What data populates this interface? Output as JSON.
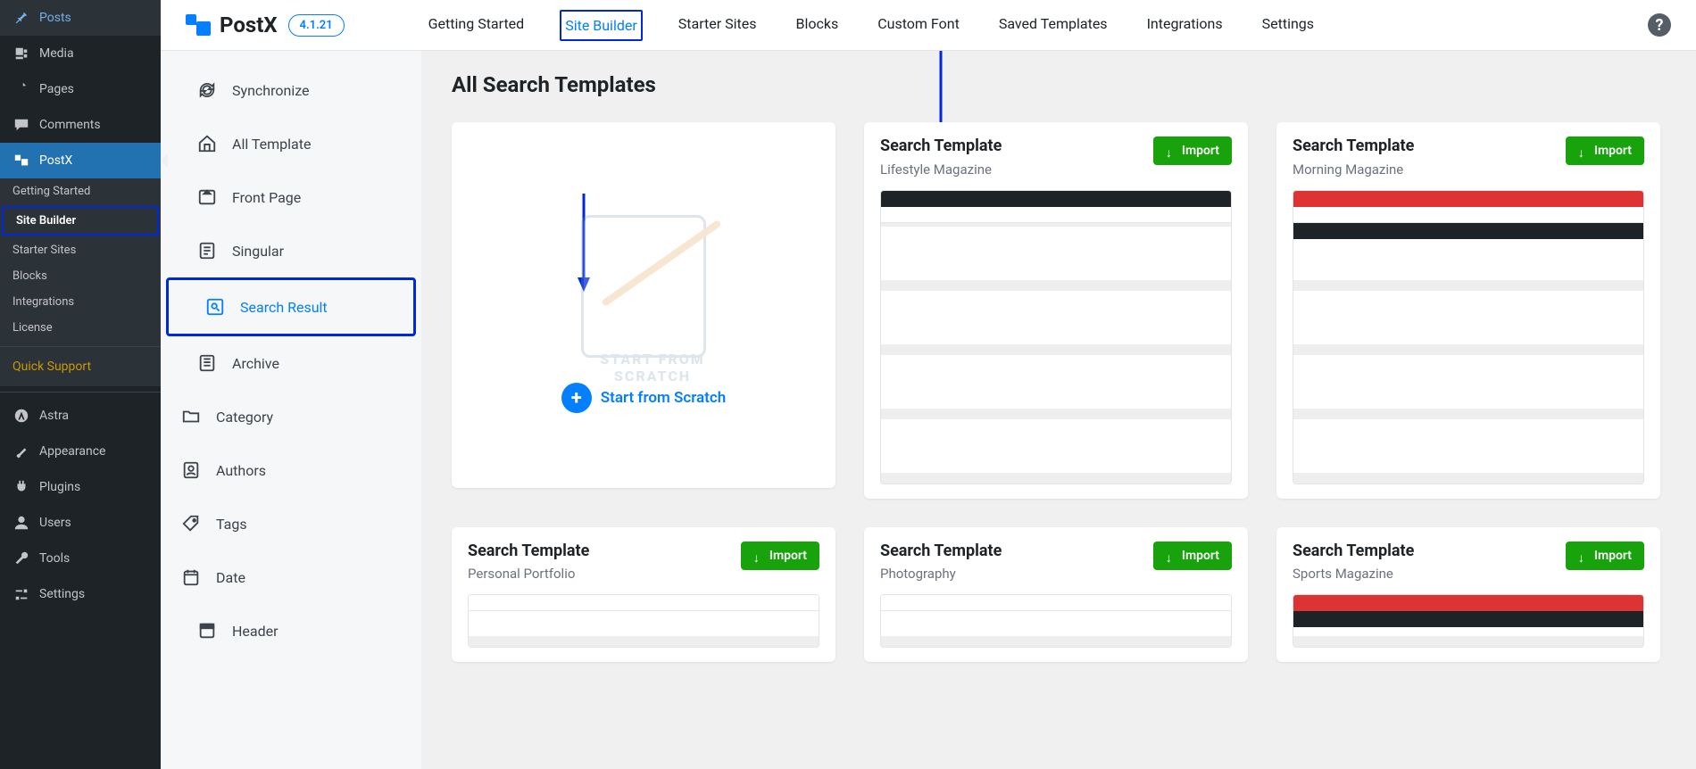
{
  "wp": {
    "posts": "Posts",
    "media": "Media",
    "pages": "Pages",
    "comments": "Comments",
    "postx": "PostX",
    "sub": {
      "getting_started": "Getting Started",
      "site_builder": "Site Builder",
      "starter_sites": "Starter Sites",
      "blocks": "Blocks",
      "integrations": "Integrations",
      "license": "License",
      "quick_support": "Quick Support"
    },
    "astra": "Astra",
    "appearance": "Appearance",
    "plugins": "Plugins",
    "users": "Users",
    "tools": "Tools",
    "settings": "Settings"
  },
  "top": {
    "brand": "PostX",
    "version": "4.1.21",
    "nav": {
      "getting_started": "Getting Started",
      "site_builder": "Site Builder",
      "starter_sites": "Starter Sites",
      "blocks": "Blocks",
      "custom_font": "Custom Font",
      "saved_templates": "Saved Templates",
      "integrations": "Integrations",
      "settings": "Settings"
    },
    "help": "?"
  },
  "builder": {
    "synchronize": "Synchronize",
    "all_template": "All Template",
    "front_page": "Front Page",
    "singular": "Singular",
    "search_result": "Search Result",
    "archive": "Archive",
    "category": "Category",
    "authors": "Authors",
    "tags": "Tags",
    "date": "Date",
    "header": "Header"
  },
  "content": {
    "title": "All Search Templates",
    "scratch_label": "Start from Scratch",
    "scratch_ghost": "START FROM SCRATCH",
    "import_label": "Import",
    "cards": [
      {
        "title": "Search Template",
        "subtitle": "Lifestyle Magazine"
      },
      {
        "title": "Search Template",
        "subtitle": "Morning Magazine"
      },
      {
        "title": "Search Template",
        "subtitle": "Personal Portfolio"
      },
      {
        "title": "Search Template",
        "subtitle": "Photography"
      },
      {
        "title": "Search Template",
        "subtitle": "Sports Magazine"
      }
    ]
  }
}
